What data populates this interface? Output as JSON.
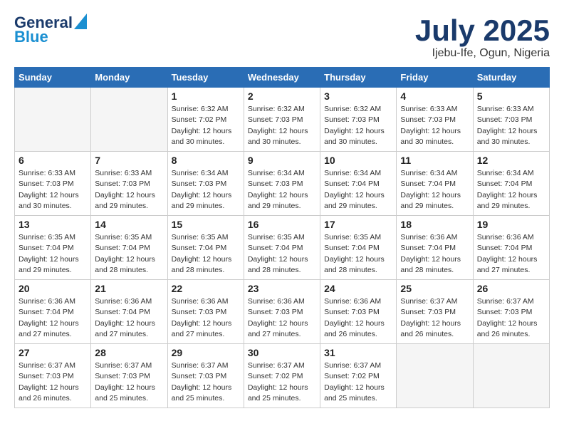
{
  "header": {
    "logo_line1": "General",
    "logo_line2": "Blue",
    "month": "July 2025",
    "location": "Ijebu-Ife, Ogun, Nigeria"
  },
  "days_of_week": [
    "Sunday",
    "Monday",
    "Tuesday",
    "Wednesday",
    "Thursday",
    "Friday",
    "Saturday"
  ],
  "weeks": [
    [
      {
        "day": "",
        "info": ""
      },
      {
        "day": "",
        "info": ""
      },
      {
        "day": "1",
        "info": "Sunrise: 6:32 AM\nSunset: 7:02 PM\nDaylight: 12 hours\nand 30 minutes."
      },
      {
        "day": "2",
        "info": "Sunrise: 6:32 AM\nSunset: 7:03 PM\nDaylight: 12 hours\nand 30 minutes."
      },
      {
        "day": "3",
        "info": "Sunrise: 6:32 AM\nSunset: 7:03 PM\nDaylight: 12 hours\nand 30 minutes."
      },
      {
        "day": "4",
        "info": "Sunrise: 6:33 AM\nSunset: 7:03 PM\nDaylight: 12 hours\nand 30 minutes."
      },
      {
        "day": "5",
        "info": "Sunrise: 6:33 AM\nSunset: 7:03 PM\nDaylight: 12 hours\nand 30 minutes."
      }
    ],
    [
      {
        "day": "6",
        "info": "Sunrise: 6:33 AM\nSunset: 7:03 PM\nDaylight: 12 hours\nand 30 minutes."
      },
      {
        "day": "7",
        "info": "Sunrise: 6:33 AM\nSunset: 7:03 PM\nDaylight: 12 hours\nand 29 minutes."
      },
      {
        "day": "8",
        "info": "Sunrise: 6:34 AM\nSunset: 7:03 PM\nDaylight: 12 hours\nand 29 minutes."
      },
      {
        "day": "9",
        "info": "Sunrise: 6:34 AM\nSunset: 7:03 PM\nDaylight: 12 hours\nand 29 minutes."
      },
      {
        "day": "10",
        "info": "Sunrise: 6:34 AM\nSunset: 7:04 PM\nDaylight: 12 hours\nand 29 minutes."
      },
      {
        "day": "11",
        "info": "Sunrise: 6:34 AM\nSunset: 7:04 PM\nDaylight: 12 hours\nand 29 minutes."
      },
      {
        "day": "12",
        "info": "Sunrise: 6:34 AM\nSunset: 7:04 PM\nDaylight: 12 hours\nand 29 minutes."
      }
    ],
    [
      {
        "day": "13",
        "info": "Sunrise: 6:35 AM\nSunset: 7:04 PM\nDaylight: 12 hours\nand 29 minutes."
      },
      {
        "day": "14",
        "info": "Sunrise: 6:35 AM\nSunset: 7:04 PM\nDaylight: 12 hours\nand 28 minutes."
      },
      {
        "day": "15",
        "info": "Sunrise: 6:35 AM\nSunset: 7:04 PM\nDaylight: 12 hours\nand 28 minutes."
      },
      {
        "day": "16",
        "info": "Sunrise: 6:35 AM\nSunset: 7:04 PM\nDaylight: 12 hours\nand 28 minutes."
      },
      {
        "day": "17",
        "info": "Sunrise: 6:35 AM\nSunset: 7:04 PM\nDaylight: 12 hours\nand 28 minutes."
      },
      {
        "day": "18",
        "info": "Sunrise: 6:36 AM\nSunset: 7:04 PM\nDaylight: 12 hours\nand 28 minutes."
      },
      {
        "day": "19",
        "info": "Sunrise: 6:36 AM\nSunset: 7:04 PM\nDaylight: 12 hours\nand 27 minutes."
      }
    ],
    [
      {
        "day": "20",
        "info": "Sunrise: 6:36 AM\nSunset: 7:04 PM\nDaylight: 12 hours\nand 27 minutes."
      },
      {
        "day": "21",
        "info": "Sunrise: 6:36 AM\nSunset: 7:04 PM\nDaylight: 12 hours\nand 27 minutes."
      },
      {
        "day": "22",
        "info": "Sunrise: 6:36 AM\nSunset: 7:03 PM\nDaylight: 12 hours\nand 27 minutes."
      },
      {
        "day": "23",
        "info": "Sunrise: 6:36 AM\nSunset: 7:03 PM\nDaylight: 12 hours\nand 27 minutes."
      },
      {
        "day": "24",
        "info": "Sunrise: 6:36 AM\nSunset: 7:03 PM\nDaylight: 12 hours\nand 26 minutes."
      },
      {
        "day": "25",
        "info": "Sunrise: 6:37 AM\nSunset: 7:03 PM\nDaylight: 12 hours\nand 26 minutes."
      },
      {
        "day": "26",
        "info": "Sunrise: 6:37 AM\nSunset: 7:03 PM\nDaylight: 12 hours\nand 26 minutes."
      }
    ],
    [
      {
        "day": "27",
        "info": "Sunrise: 6:37 AM\nSunset: 7:03 PM\nDaylight: 12 hours\nand 26 minutes."
      },
      {
        "day": "28",
        "info": "Sunrise: 6:37 AM\nSunset: 7:03 PM\nDaylight: 12 hours\nand 25 minutes."
      },
      {
        "day": "29",
        "info": "Sunrise: 6:37 AM\nSunset: 7:03 PM\nDaylight: 12 hours\nand 25 minutes."
      },
      {
        "day": "30",
        "info": "Sunrise: 6:37 AM\nSunset: 7:02 PM\nDaylight: 12 hours\nand 25 minutes."
      },
      {
        "day": "31",
        "info": "Sunrise: 6:37 AM\nSunset: 7:02 PM\nDaylight: 12 hours\nand 25 minutes."
      },
      {
        "day": "",
        "info": ""
      },
      {
        "day": "",
        "info": ""
      }
    ]
  ]
}
